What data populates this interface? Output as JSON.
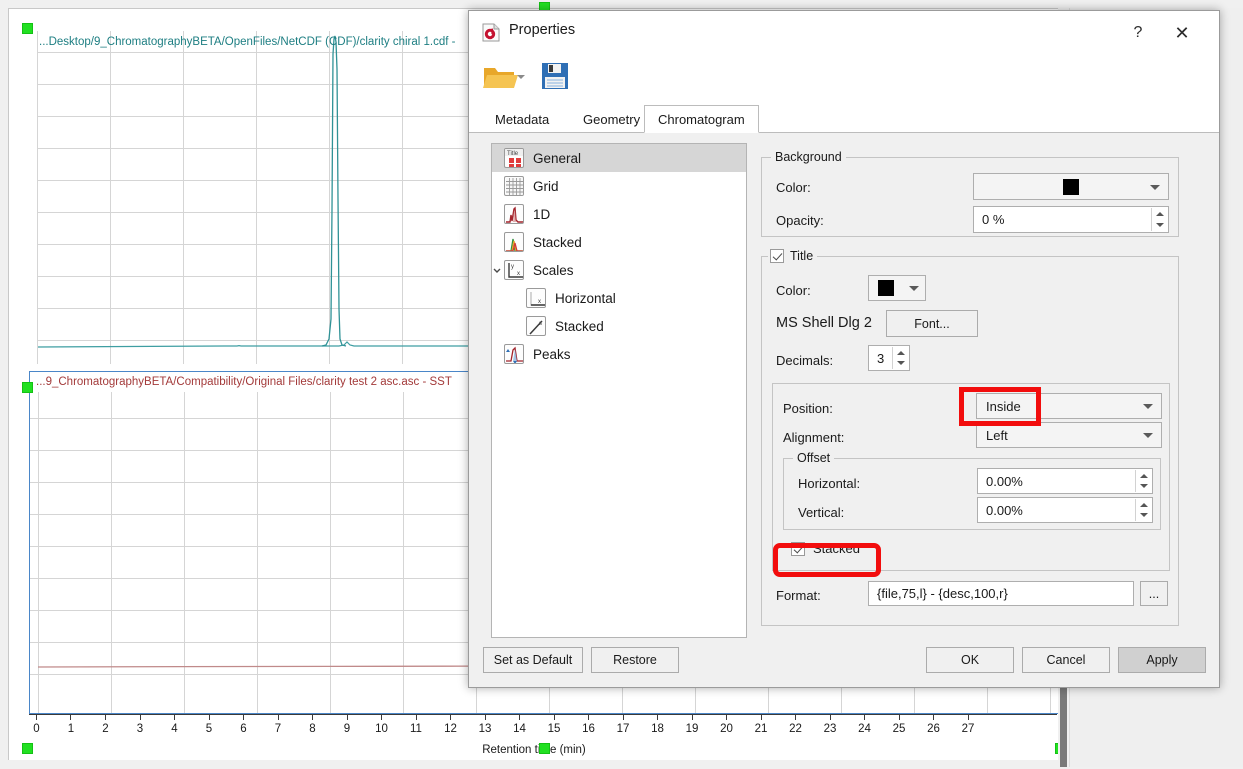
{
  "app": {
    "background_window": {
      "axis_label": "Retention time (min)",
      "chart_top_title": "...Desktop/9_ChromatographyBETA/OpenFiles/NetCDF (CDF)/clarity chiral 1.cdf - ",
      "chart_bottom_title": "...9_ChromatographyBETA/Compatibility/Original Files/clarity test 2 asc.asc - SST ",
      "x_ticks": [
        "0",
        "1",
        "2",
        "3",
        "4",
        "5",
        "6",
        "7",
        "8",
        "9",
        "10",
        "11",
        "12",
        "13",
        "14",
        "15",
        "16",
        "17",
        "18",
        "19",
        "20",
        "21",
        "22",
        "23",
        "24",
        "25",
        "26",
        "27"
      ],
      "trace_top_color": "#2f9296",
      "trace_bottom_color": "#b35454",
      "selection_handle_color": "#21e021"
    }
  },
  "dialog": {
    "title": "Properties",
    "title_icon": "properties-document-icon",
    "help_label": "?",
    "close_label": "✕",
    "toolbar": {
      "open_icon": "open-folder-icon",
      "open_dropdown_icon": "chevron-down-icon",
      "save_icon": "save-floppy-icon"
    },
    "tabs": [
      {
        "label": "Metadata",
        "active": false
      },
      {
        "label": "Geometry",
        "active": false
      },
      {
        "label": "Chromatogram",
        "active": true
      }
    ],
    "tree": [
      {
        "label": "General",
        "icon": "title-icon",
        "level": 0,
        "selected": true,
        "caret": false
      },
      {
        "label": "Grid",
        "icon": "grid-icon",
        "level": 0,
        "selected": false,
        "caret": false
      },
      {
        "label": "1D",
        "icon": "chromatogram-1d-icon",
        "level": 0,
        "selected": false,
        "caret": false
      },
      {
        "label": "Stacked",
        "icon": "stacked-traces-icon",
        "level": 0,
        "selected": false,
        "caret": false
      },
      {
        "label": "Scales",
        "icon": "axes-icon",
        "level": 0,
        "selected": false,
        "caret": true
      },
      {
        "label": "Horizontal",
        "icon": "x-axis-icon",
        "level": 1,
        "selected": false,
        "caret": false
      },
      {
        "label": "Stacked",
        "icon": "slope-axis-icon",
        "level": 1,
        "selected": false,
        "caret": false
      },
      {
        "label": "Peaks",
        "icon": "peaks-icon",
        "level": 0,
        "selected": false,
        "caret": false
      }
    ],
    "background_group": {
      "legend": "Background",
      "color_label": "Color:",
      "color_value": "#000000",
      "opacity_label": "Opacity:",
      "opacity_value": "0 %"
    },
    "title_group": {
      "legend": "Title",
      "checked": true,
      "color_label": "Color:",
      "color_value": "#000000",
      "font_name": "MS Shell Dlg 2",
      "font_button": "Font...",
      "decimals_label": "Decimals:",
      "decimals_value": "3",
      "position_label": "Position:",
      "position_value": "Inside",
      "alignment_label": "Alignment:",
      "alignment_value": "Left",
      "offset_legend": "Offset",
      "horizontal_label": "Horizontal:",
      "horizontal_value": "0.00%",
      "vertical_label": "Vertical:",
      "vertical_value": "0.00%",
      "stacked_label": "Stacked",
      "stacked_checked": true,
      "format_label": "Format:",
      "format_value": "{file,75,l} - {desc,100,r}",
      "format_browse_label": "..."
    },
    "footer": {
      "set_default": "Set as Default",
      "restore": "Restore",
      "ok": "OK",
      "cancel": "Cancel",
      "apply": "Apply"
    },
    "highlights": {
      "color": "#f20d0d"
    }
  }
}
